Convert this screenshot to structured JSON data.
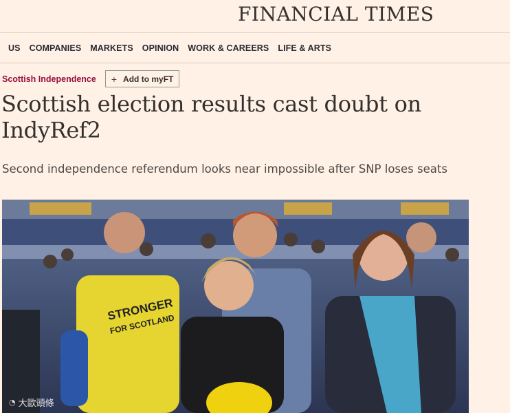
{
  "masthead": {
    "logo": "FINANCIAL TIMES"
  },
  "nav": {
    "items": [
      "US",
      "COMPANIES",
      "MARKETS",
      "OPINION",
      "WORK & CAREERS",
      "LIFE & ARTS"
    ]
  },
  "article": {
    "topic": "Scottish Independence",
    "myft_button": {
      "icon": "plus-icon",
      "label": "Add to myFT"
    },
    "headline": "Scottish election results cast doubt on IndyRef2",
    "standfirst": "Second independence referendum looks near impossible after SNP loses seats"
  },
  "photo": {
    "shirt_text": "STRONGER FOR SCOTLAND",
    "watermark": "大歐頭條"
  },
  "colors": {
    "background": "#fff1e5",
    "topic": "#990f3d",
    "text": "#33302e"
  }
}
